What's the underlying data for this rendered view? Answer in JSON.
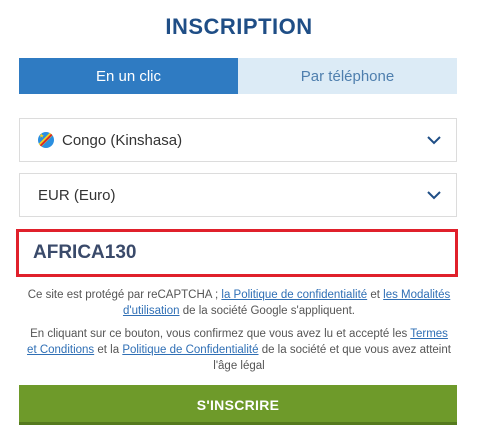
{
  "header": {
    "title": "INSCRIPTION"
  },
  "tabs": [
    {
      "label": "En un clic",
      "active": true
    },
    {
      "label": "Par téléphone",
      "active": false
    }
  ],
  "country_select": {
    "value": "Congo (Kinshasa)",
    "icon": "drc-flag-icon"
  },
  "currency_select": {
    "value": "EUR (Euro)"
  },
  "promo_code": {
    "value": "AFRICA130"
  },
  "recaptcha_notice": {
    "prefix": "Ce site est protégé par reCAPTCHA ; ",
    "privacy_link": "la Politique de confidentialité",
    "middle": " et ",
    "terms_link": "les Modalités d'utilisation",
    "suffix": " de la société Google s'appliquent."
  },
  "consent_notice": {
    "prefix": "En cliquant sur ce bouton, vous confirmez que vous avez lu et accepté les ",
    "terms_link": "Termes et Conditions",
    "middle": " et la ",
    "privacy_link": "Politique de Confidentialité",
    "suffix": " de la société et que vous avez atteint l'âge légal"
  },
  "submit": {
    "label": "S'INSCRIRE"
  },
  "colors": {
    "title": "#1f4e86",
    "tab_active": "#2f7bc2",
    "tab_inactive": "#dcebf6",
    "promo_border": "#e0202b",
    "link": "#2f6fb5",
    "submit": "#6e9a2a"
  }
}
